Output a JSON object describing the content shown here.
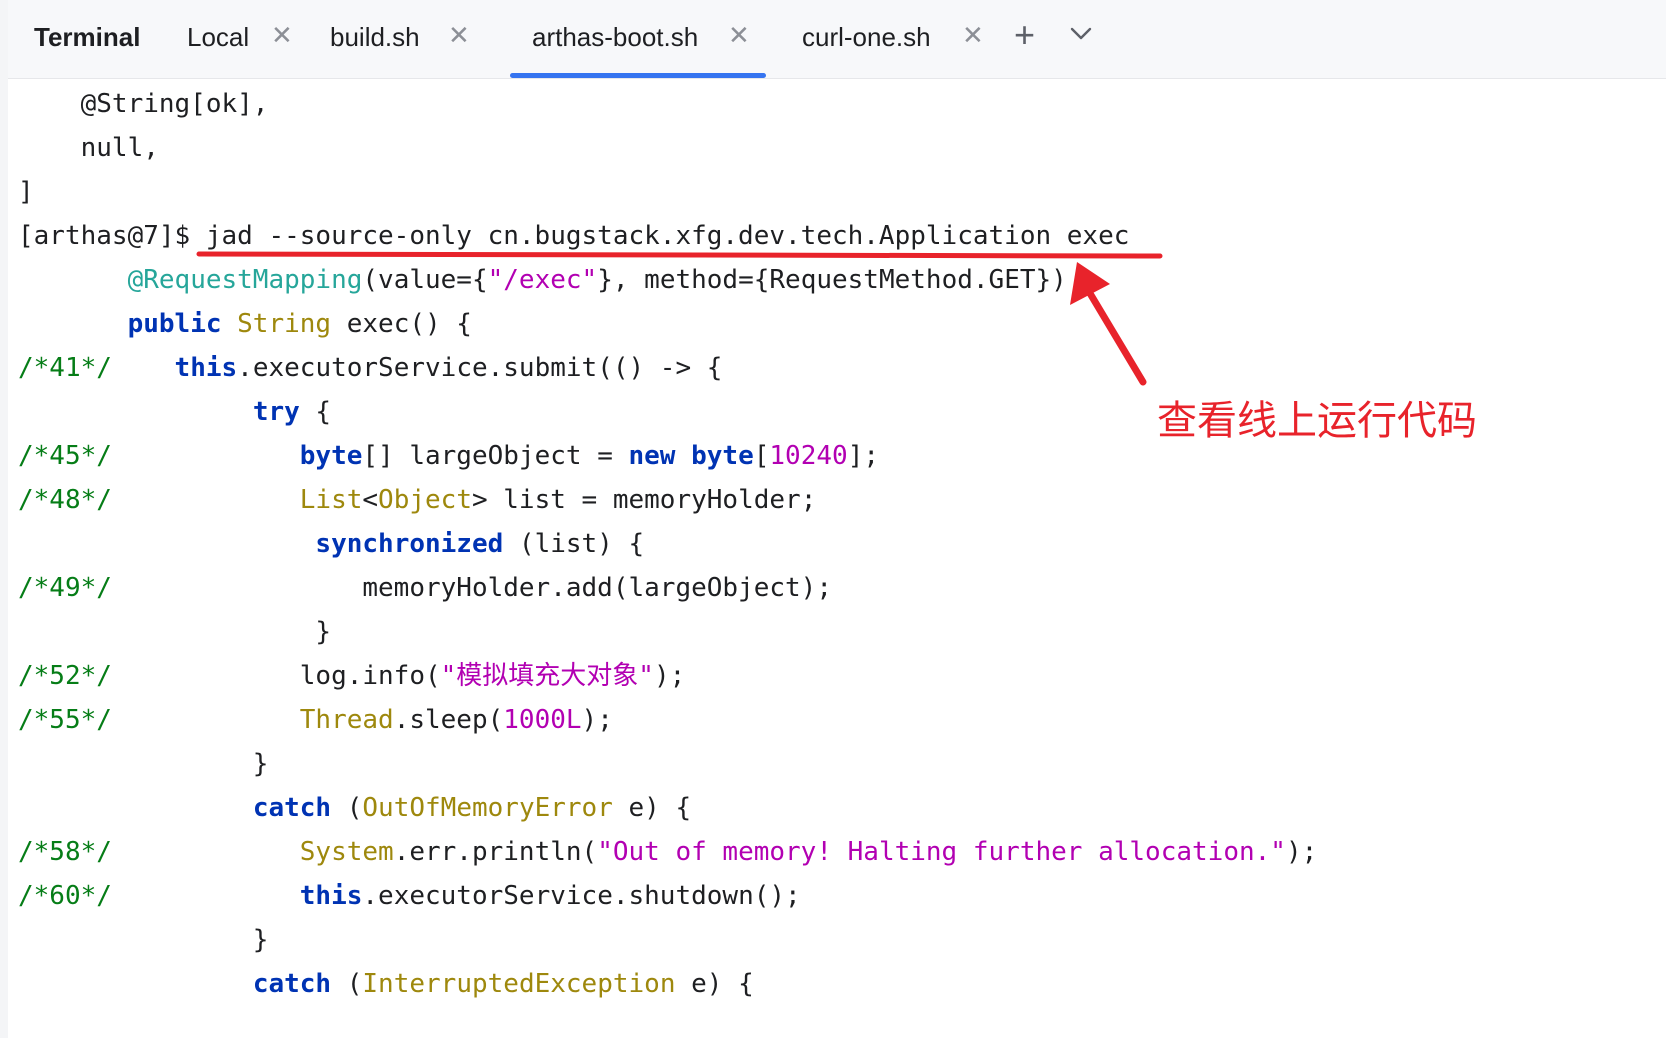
{
  "tool_window": {
    "title": "Terminal"
  },
  "tabs": [
    {
      "label": "Local",
      "active": false
    },
    {
      "label": "build.sh",
      "active": false
    },
    {
      "label": "arthas-boot.sh",
      "active": true
    },
    {
      "label": "curl-one.sh",
      "active": false
    }
  ],
  "tab_icons": {
    "close": "close-icon",
    "add": "plus-icon",
    "more": "chevron-down-icon"
  },
  "colors": {
    "accent": "#3574f0",
    "annotation": "#e8232b",
    "keyword": "#0033b3",
    "type": "#9e880d",
    "string": "#b200b2",
    "gutter": "#067d17"
  },
  "terminal": {
    "lines": [
      {
        "gutter": "",
        "tokens": [
          {
            "t": "    @String[ok],"
          }
        ]
      },
      {
        "gutter": "",
        "tokens": [
          {
            "t": "    null,"
          }
        ]
      },
      {
        "gutter": "",
        "tokens": [
          {
            "t": "]"
          }
        ]
      },
      {
        "gutter": "",
        "tokens": [
          {
            "t": "[arthas@7]$ jad --source-only cn.bugstack.xfg.dev.tech.Application exec"
          }
        ]
      },
      {
        "gutter": "",
        "tokens": [
          {
            "t": "       "
          },
          {
            "t": "@RequestMapping",
            "c": "ann"
          },
          {
            "t": "(value={"
          },
          {
            "t": "\"/exec\"",
            "c": "str"
          },
          {
            "t": "}, method={RequestMethod.GET})"
          }
        ]
      },
      {
        "gutter": "",
        "tokens": [
          {
            "t": "       "
          },
          {
            "t": "public",
            "c": "kw"
          },
          {
            "t": " "
          },
          {
            "t": "String",
            "c": "type"
          },
          {
            "t": " exec() {"
          }
        ]
      },
      {
        "gutter": "/*41*/",
        "tokens": [
          {
            "t": "    "
          },
          {
            "t": "this",
            "c": "kw"
          },
          {
            "t": ".executorService.submit(() -> {"
          }
        ]
      },
      {
        "gutter": "",
        "tokens": [
          {
            "t": "               "
          },
          {
            "t": "try",
            "c": "kw"
          },
          {
            "t": " {"
          }
        ]
      },
      {
        "gutter": "/*45*/",
        "tokens": [
          {
            "t": "            "
          },
          {
            "t": "byte",
            "c": "kw"
          },
          {
            "t": "[] largeObject = "
          },
          {
            "t": "new",
            "c": "kw"
          },
          {
            "t": " "
          },
          {
            "t": "byte",
            "c": "kw"
          },
          {
            "t": "["
          },
          {
            "t": "10240",
            "c": "num"
          },
          {
            "t": "];"
          }
        ]
      },
      {
        "gutter": "/*48*/",
        "tokens": [
          {
            "t": "            "
          },
          {
            "t": "List",
            "c": "type"
          },
          {
            "t": "<"
          },
          {
            "t": "Object",
            "c": "type"
          },
          {
            "t": "> list = memoryHolder;"
          }
        ]
      },
      {
        "gutter": "",
        "tokens": [
          {
            "t": "                   "
          },
          {
            "t": "synchronized",
            "c": "kw"
          },
          {
            "t": " (list) {"
          }
        ]
      },
      {
        "gutter": "/*49*/",
        "tokens": [
          {
            "t": "                memoryHolder.add(largeObject);"
          }
        ]
      },
      {
        "gutter": "",
        "tokens": [
          {
            "t": "                   }"
          }
        ]
      },
      {
        "gutter": "/*52*/",
        "tokens": [
          {
            "t": "            log.info("
          },
          {
            "t": "\"模拟填充大对象\"",
            "c": "str"
          },
          {
            "t": ");"
          }
        ]
      },
      {
        "gutter": "/*55*/",
        "tokens": [
          {
            "t": "            "
          },
          {
            "t": "Thread",
            "c": "type"
          },
          {
            "t": ".sleep("
          },
          {
            "t": "1000L",
            "c": "num"
          },
          {
            "t": ");"
          }
        ]
      },
      {
        "gutter": "",
        "tokens": [
          {
            "t": "               }"
          }
        ]
      },
      {
        "gutter": "",
        "tokens": [
          {
            "t": "               "
          },
          {
            "t": "catch",
            "c": "kw"
          },
          {
            "t": " ("
          },
          {
            "t": "OutOfMemoryError",
            "c": "type"
          },
          {
            "t": " e) {"
          }
        ]
      },
      {
        "gutter": "/*58*/",
        "tokens": [
          {
            "t": "            "
          },
          {
            "t": "System",
            "c": "type"
          },
          {
            "t": ".err.println("
          },
          {
            "t": "\"Out of memory! Halting further allocation.\"",
            "c": "str"
          },
          {
            "t": ");"
          }
        ]
      },
      {
        "gutter": "/*60*/",
        "tokens": [
          {
            "t": "            "
          },
          {
            "t": "this",
            "c": "kw"
          },
          {
            "t": ".executorService.shutdown();"
          }
        ]
      },
      {
        "gutter": "",
        "tokens": [
          {
            "t": "               }"
          }
        ]
      },
      {
        "gutter": "",
        "tokens": [
          {
            "t": "               "
          },
          {
            "t": "catch",
            "c": "kw"
          },
          {
            "t": " ("
          },
          {
            "t": "InterruptedException",
            "c": "type"
          },
          {
            "t": " e) {"
          }
        ]
      }
    ]
  },
  "annotation": {
    "text": "查看线上运行代码"
  }
}
